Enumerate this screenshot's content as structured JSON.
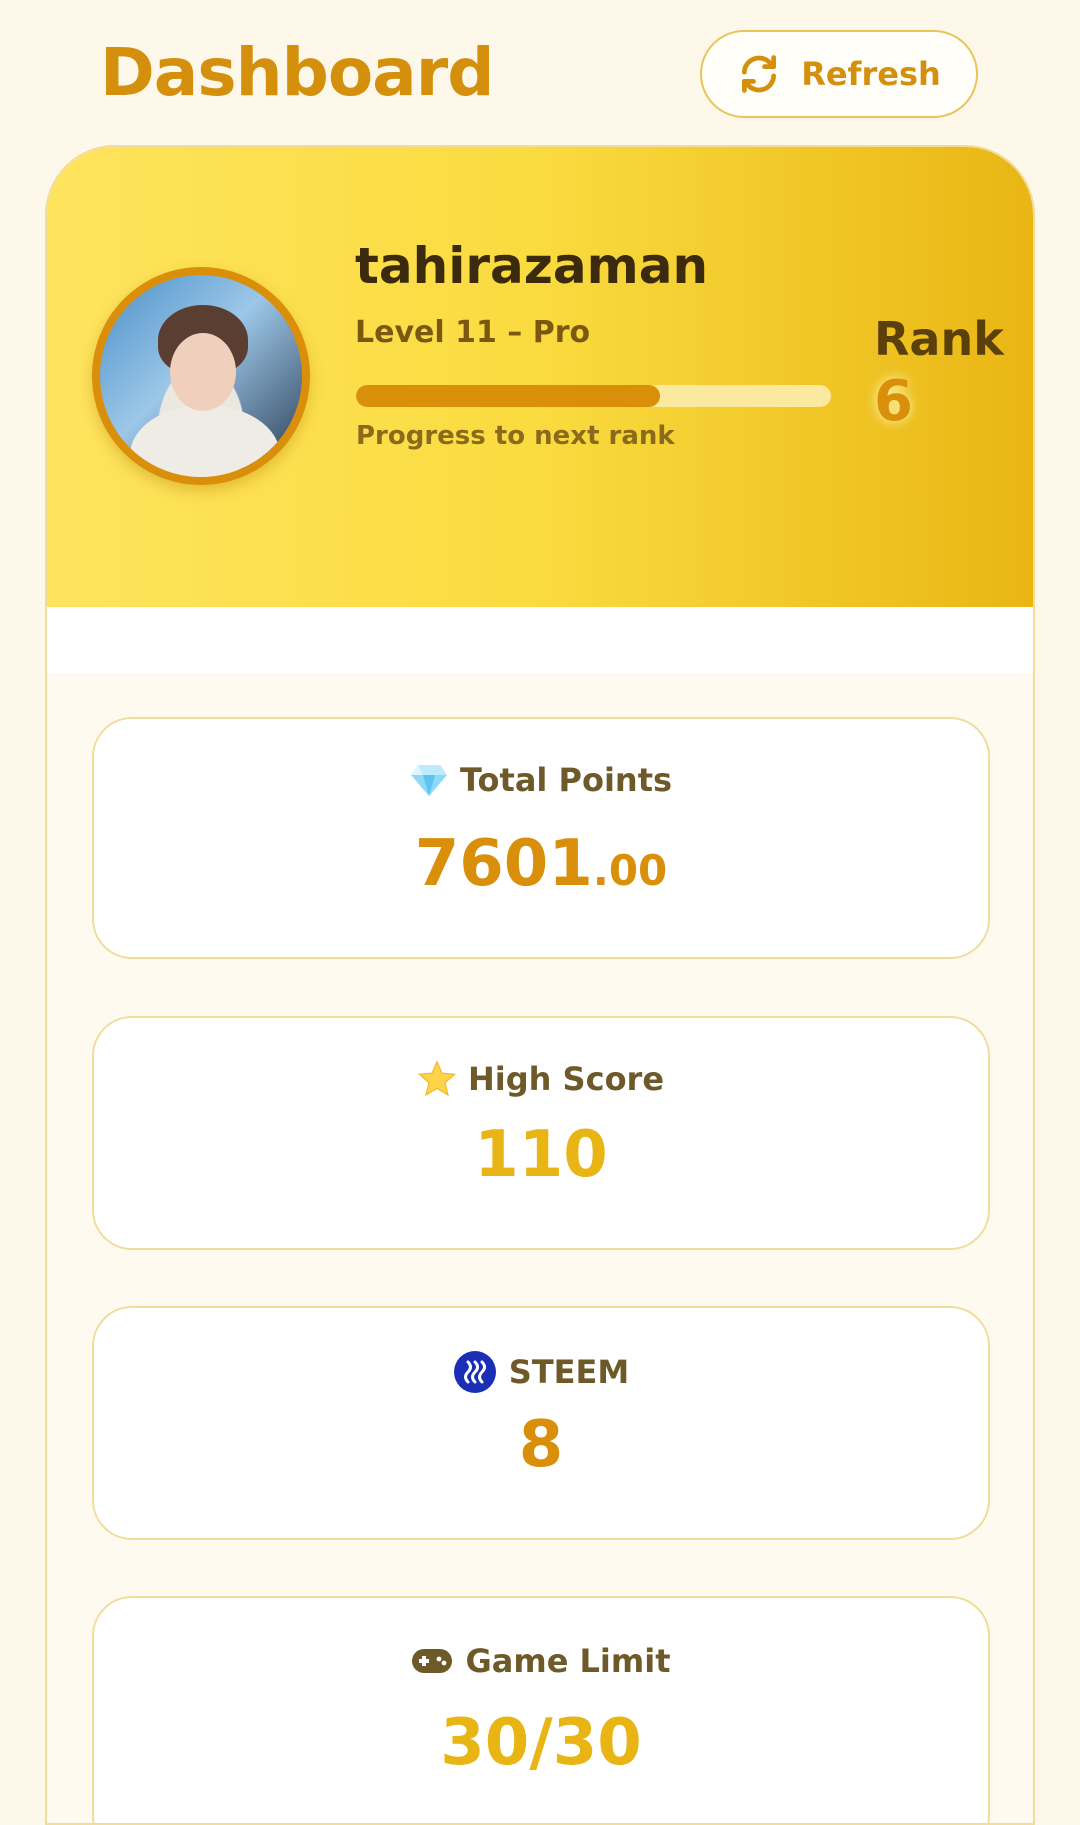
{
  "header": {
    "title": "Dashboard",
    "refresh_label": "Refresh"
  },
  "profile": {
    "username": "tahirazaman",
    "level_text": "Level 11 – Pro",
    "progress_fraction": 0.64,
    "progress_label": "Progress to next rank",
    "rank_label": "Rank",
    "rank_value": "6"
  },
  "stats": {
    "total_points": {
      "icon": "diamond-icon",
      "label": "Total Points",
      "value_int": "7601",
      "value_dec": ".00"
    },
    "high_score": {
      "icon": "star-icon",
      "label": "High Score",
      "value": "110"
    },
    "steem": {
      "icon": "steem-icon",
      "label": "STEEM",
      "value": "8"
    },
    "game_limit": {
      "icon": "gamepad-icon",
      "label": "Game Limit",
      "value": "30/30"
    }
  },
  "colors": {
    "accent": "#d98f0a",
    "accent_light": "#e8b514",
    "hero_start": "#fee45e",
    "hero_end": "#e9b614",
    "steem_blue": "#1a2fb5"
  }
}
